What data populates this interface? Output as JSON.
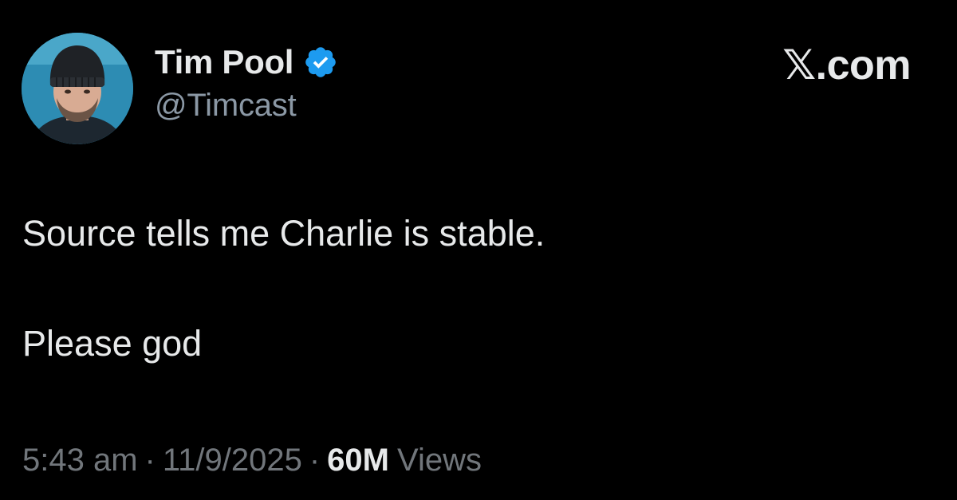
{
  "author": {
    "display_name": "Tim Pool",
    "handle": "@Timcast",
    "verified": true
  },
  "brand": {
    "label": "𝕏.com"
  },
  "tweet": {
    "lines": [
      "Source tells me Charlie is stable.",
      "Please god"
    ]
  },
  "meta": {
    "time": "5:43 am",
    "separator": "·",
    "date": "11/9/2025",
    "views_count": "60M",
    "views_label": "Views"
  },
  "colors": {
    "background": "#000000",
    "primary_text": "#e7e9ea",
    "secondary_text": "#71767b",
    "verified_blue": "#1d9bf0"
  },
  "icons": {
    "verified": "verified-badge-icon",
    "avatar": "profile-photo"
  }
}
